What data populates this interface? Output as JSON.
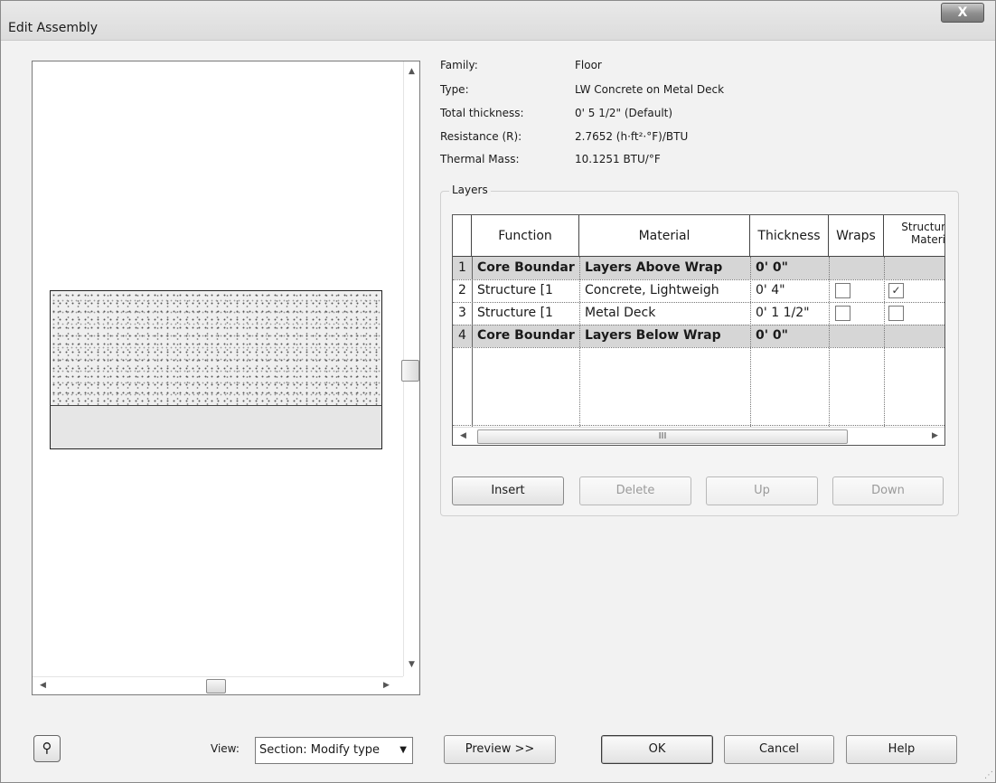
{
  "window": {
    "title": "Edit Assembly",
    "close_label": "X"
  },
  "properties": [
    {
      "label": "Family:",
      "value": "Floor"
    },
    {
      "label": "Type:",
      "value": "LW Concrete on Metal Deck"
    },
    {
      "label": "Total thickness:",
      "value": "0'  5 1/2\" (Default)"
    },
    {
      "label": "Resistance (R):",
      "value": "2.7652 (h·ft²·°F)/BTU"
    },
    {
      "label": "Thermal Mass:",
      "value": "10.1251 BTU/°F"
    }
  ],
  "layers": {
    "legend": "Layers",
    "headers": {
      "function": "Function",
      "material": "Material",
      "thickness": "Thickness",
      "wraps": "Wraps",
      "structural_line1": "Structur",
      "structural_line2": "Materi"
    },
    "rows": [
      {
        "num": "1",
        "function": "Core Boundar",
        "material": "Layers Above Wrap",
        "thickness": "0'  0\"",
        "wraps": null,
        "structural": null,
        "bold": true
      },
      {
        "num": "2",
        "function": "Structure [1",
        "material": "Concrete, Lightweigh",
        "thickness": "0'  4\"",
        "wraps": false,
        "structural": true,
        "bold": false
      },
      {
        "num": "3",
        "function": "Structure [1",
        "material": "Metal Deck",
        "thickness": "0'  1 1/2\"",
        "wraps": false,
        "structural": false,
        "bold": false
      },
      {
        "num": "4",
        "function": "Core Boundar",
        "material": "Layers Below Wrap",
        "thickness": "0'  0\"",
        "wraps": null,
        "structural": null,
        "bold": true
      }
    ],
    "scroll_grip": "III"
  },
  "layer_buttons": {
    "insert": "Insert",
    "delete": "Delete",
    "up": "Up",
    "down": "Down"
  },
  "footer": {
    "view_label": "View:",
    "view_value": "Section: Modify type",
    "preview": "Preview >>",
    "ok": "OK",
    "cancel": "Cancel",
    "help": "Help"
  },
  "icons": {
    "help_icon": "zoom-help-icon"
  }
}
